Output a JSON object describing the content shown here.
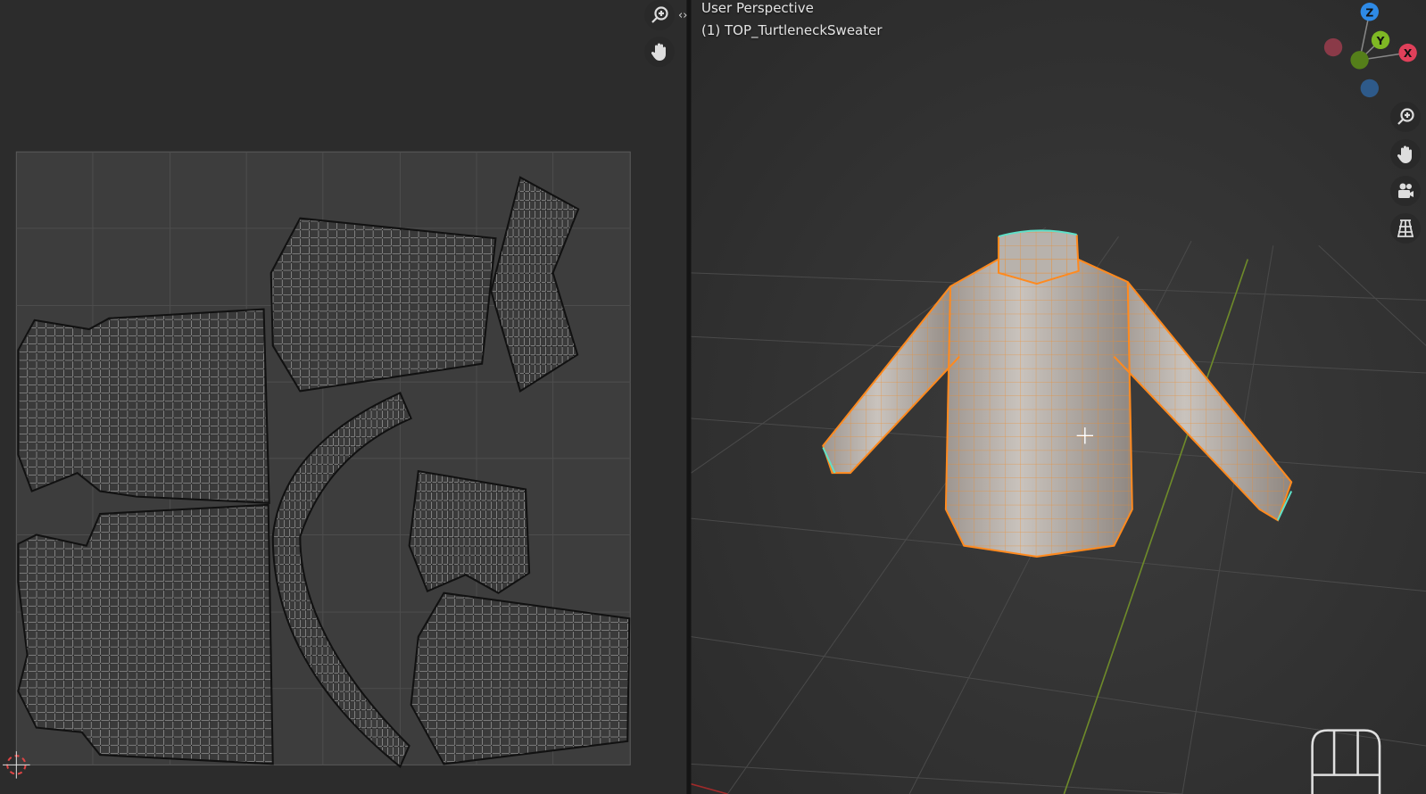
{
  "viewport": {
    "view_name": "User Perspective",
    "object_label": "(1) TOP_TurtleneckSweater"
  },
  "gizmo": {
    "z": "Z",
    "y": "Y",
    "x": "X",
    "colors": {
      "x": "#e0405a",
      "y": "#7fb824",
      "z": "#2e8ae6"
    }
  },
  "uv_editor": {
    "tools": [
      "zoom-icon",
      "pan-icon"
    ]
  },
  "viewport_tools": [
    "zoom-icon",
    "pan-icon",
    "camera-icon",
    "grid-icon"
  ],
  "colors": {
    "background": "#2b2b2b",
    "selection_outline": "#ff8a1f",
    "boundary_edge": "#5fe0c8"
  }
}
